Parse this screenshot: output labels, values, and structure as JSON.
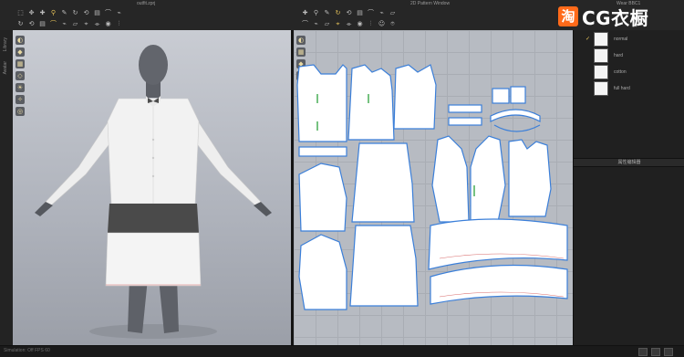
{
  "windows": {
    "viewport3d_title": "outfit.zprj",
    "viewport2d_title": "2D Pattern Window",
    "panel_title": "Wear BBC1"
  },
  "brand": {
    "logo_char": "淘",
    "logo_text": "CG衣橱",
    "accent": "#ff6a1a"
  },
  "toolbar": {
    "left_icons": [
      "select-icon",
      "transform-icon",
      "move-icon",
      "pin-icon",
      "brush-icon",
      "wrap-icon",
      "rotate-icon",
      "arrange-icon",
      "fold-icon",
      "tuck-icon",
      "flatten-icon",
      "measure-icon",
      "tape-icon",
      "button-icon",
      "zip-icon",
      "avatar-icon",
      "camera-icon",
      "layer-icon",
      "gear-icon",
      "texture-icon"
    ],
    "right_icons": [
      "select-pattern-icon",
      "edit-pattern-icon",
      "polygon-icon",
      "rectangle-icon",
      "circle-icon",
      "dart-icon",
      "internal-line-icon",
      "trace-icon",
      "segment-icon",
      "seam-icon",
      "free-seam-icon",
      "fold-arrange-icon",
      "topstitch-icon",
      "edit-texture-icon",
      "symmetry-icon",
      "sewing-icon",
      "grade-icon",
      "annotation-icon"
    ]
  },
  "left_strip": {
    "labels": [
      "Library",
      "Avatar"
    ]
  },
  "fabrics": [
    {
      "label": "normal",
      "checked": true
    },
    {
      "label": "hard",
      "checked": false
    },
    {
      "label": "cotton",
      "checked": false
    },
    {
      "label": "full hard",
      "checked": false
    }
  ],
  "property_editor": {
    "title": "属性编辑器"
  },
  "status": {
    "text": "Simulation: Off   FPS 60"
  },
  "colors": {
    "seam_blue": "#3b7fd9",
    "fabric_white": "#ffffff",
    "panel_dark": "#202020"
  }
}
